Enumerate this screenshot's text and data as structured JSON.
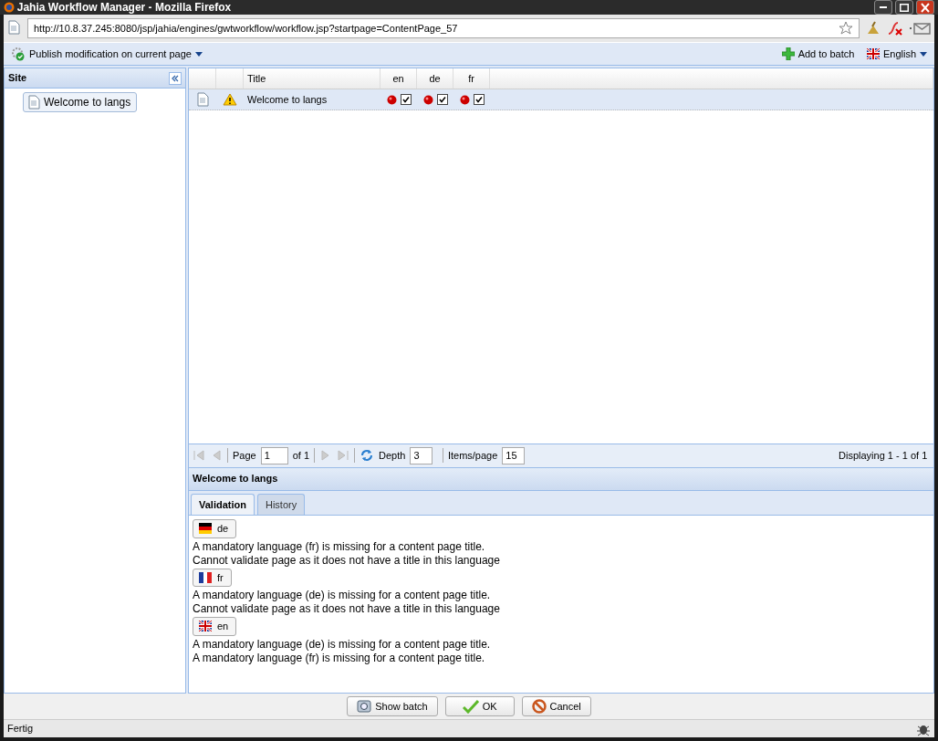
{
  "window": {
    "title": "Jahia Workflow Manager - Mozilla Firefox"
  },
  "address_bar": {
    "url": "http://10.8.37.245:8080/jsp/jahia/engines/gwtworkflow/workflow.jsp?startpage=ContentPage_57"
  },
  "toolbar": {
    "publish_menu": "Publish modification on current page",
    "add_to_batch": "Add to batch",
    "language_menu": "English"
  },
  "site_panel": {
    "title": "Site",
    "items": [
      {
        "label": "Welcome to langs",
        "selected": true
      }
    ]
  },
  "grid": {
    "columns": [
      "Title",
      "en",
      "de",
      "fr"
    ],
    "rows": [
      {
        "title": "Welcome to langs",
        "warning": true,
        "selected": true,
        "languages": [
          {
            "checked": true
          },
          {
            "checked": true
          },
          {
            "checked": true
          }
        ]
      }
    ]
  },
  "paging": {
    "page_label": "Page",
    "page": "1",
    "of": "of 1",
    "depth_label": "Depth",
    "depth": "3",
    "items_label": "Items/page",
    "items": "15",
    "displaying": "Displaying 1 - 1 of 1"
  },
  "detail": {
    "title": "Welcome to langs",
    "tabs": [
      {
        "label": "Validation",
        "selected": true
      },
      {
        "label": "History",
        "selected": false
      }
    ],
    "sections": [
      {
        "language": "de",
        "kind": "german",
        "messages": [
          "A mandatory language (fr) is missing for a content page title.",
          "Cannot validate page as it does not have a title in this language"
        ]
      },
      {
        "language": "fr",
        "kind": "french",
        "messages": [
          "A mandatory language (de) is missing for a content page title.",
          "Cannot validate page as it does not have a title in this language"
        ]
      },
      {
        "language": "en",
        "kind": "british",
        "messages": [
          "A mandatory language (de) is missing for a content page title.",
          "A mandatory language (fr) is missing for a content page title."
        ]
      }
    ]
  },
  "buttons": [
    {
      "label": "Show batch",
      "kind": "batch"
    },
    {
      "label": "OK",
      "kind": "ok"
    },
    {
      "label": "Cancel",
      "kind": "cancel"
    }
  ],
  "status_bar": {
    "text": "Fertig"
  }
}
